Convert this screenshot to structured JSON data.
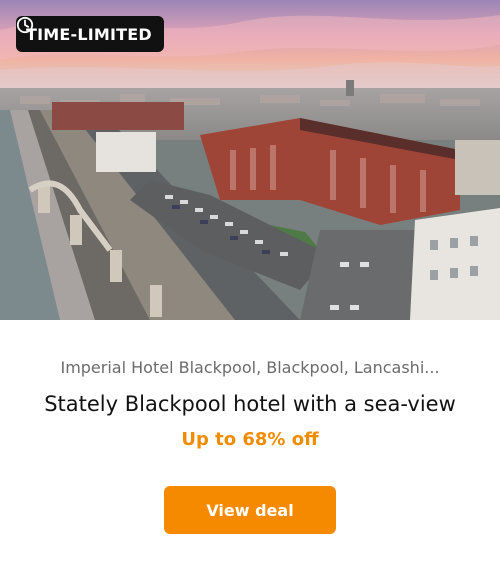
{
  "badge": {
    "label": "TIME-LIMITED",
    "icon": "clock-icon"
  },
  "hero": {
    "image": "aerial-view-of-imperial-hotel-blackpool-seafront"
  },
  "listing": {
    "location": "Imperial Hotel Blackpool, Blackpool, Lancashi...",
    "title": "Stately Blackpool hotel with a sea-view",
    "discount": "Up to 68% off"
  },
  "cta": {
    "label": "View deal"
  },
  "colors": {
    "accent": "#f58a00",
    "discount_text": "#f08c00",
    "badge_bg": "#111111"
  }
}
